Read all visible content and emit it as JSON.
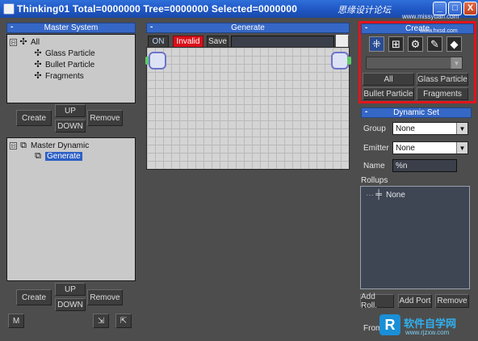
{
  "window": {
    "title": "Thinking01  Total=0000000  Tree=0000000  Selected=0000000",
    "minimize_label": "_",
    "maximize_label": "□",
    "close_label": "X",
    "watermark_text": "思缘设计论坛",
    "watermark_url": "www.missyuan.com"
  },
  "master_system": {
    "header": "Master System",
    "collapse": "-",
    "tree": {
      "root": "All",
      "expander": "⊟",
      "children": [
        "Glass Particle",
        "Bullet Particle",
        "Fragments"
      ]
    },
    "buttons": {
      "create": "Create",
      "up": "UP",
      "down": "DOWN",
      "remove": "Remove"
    }
  },
  "master_dynamic": {
    "tree": {
      "root": "Master Dynamic",
      "expander": "⊟",
      "child": "Generate"
    },
    "buttons": {
      "create": "Create",
      "up": "UP",
      "down": "DOWN",
      "remove": "Remove"
    },
    "m_button": "M"
  },
  "generate": {
    "header": "Generate",
    "collapse": "-",
    "toolbar": {
      "on": "ON",
      "invalid": "Invalid",
      "save": "Save",
      "name_value": ""
    }
  },
  "create_panel": {
    "header": "Create",
    "collapse": "-",
    "watermark": "www.hxsd.com",
    "icons": [
      "node-add-icon",
      "ok-node-icon",
      "gear-icon",
      "wrench-icon",
      "cube-icon"
    ],
    "dropdown_value": "",
    "buttons": {
      "all": "All",
      "glass": "Glass Particle",
      "bullet": "Bullet Particle",
      "fragments": "Fragments"
    }
  },
  "dynamic_set": {
    "header": "Dynamic Set",
    "collapse": "-",
    "group_label": "Group",
    "group_value": "None",
    "emitter_label": "Emitter",
    "emitter_value": "None",
    "name_label": "Name",
    "name_value": "%n",
    "rollups_label": "Rollups",
    "rollup_item": "None",
    "buttons": {
      "add_roll": "Add Roll.",
      "add_port": "Add Port",
      "remove": "Remove"
    },
    "from_label": "From"
  },
  "footer_logo": {
    "badge": "R",
    "text": "软件自学网",
    "url": "www.rjzxw.com"
  },
  "colors": {
    "accent": "#3567c6",
    "invalid": "#d9101a",
    "highlight": "#e3141c"
  }
}
